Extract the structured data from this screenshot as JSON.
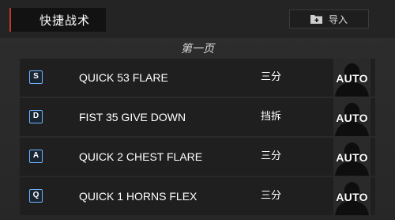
{
  "header": {
    "title": "快捷战术",
    "import_label": "导入"
  },
  "page_title": "第一页",
  "plays": [
    {
      "key": "S",
      "name": "QUICK 53 FLARE",
      "type": "三分",
      "auto_label": "AUTO"
    },
    {
      "key": "D",
      "name": "FIST 35 GIVE DOWN",
      "type": "挡拆",
      "auto_label": "AUTO"
    },
    {
      "key": "A",
      "name": "QUICK 2 CHEST FLARE",
      "type": "三分",
      "auto_label": "AUTO"
    },
    {
      "key": "Q",
      "name": "QUICK 1 HORNS FLEX",
      "type": "三分",
      "auto_label": "AUTO"
    }
  ],
  "icons": {
    "import": "folder-add-icon",
    "player": "player-silhouette-icon"
  },
  "colors": {
    "accent": "#c0392b",
    "key_badge_border": "#6fb4ff",
    "row_bg": "#1f1f1f"
  }
}
